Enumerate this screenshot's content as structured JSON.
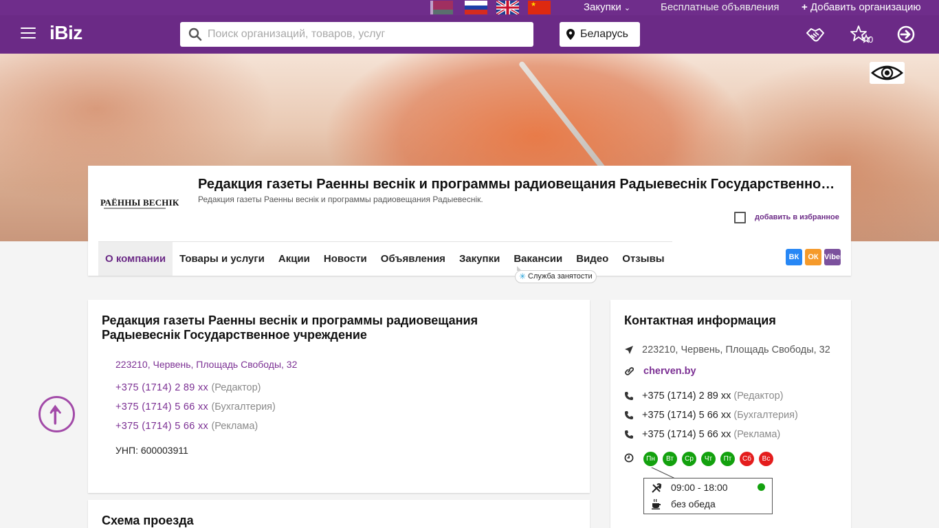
{
  "header": {
    "languages": [
      "by",
      "ru",
      "en",
      "cn"
    ],
    "top_links": {
      "purchases": "Закупки",
      "free_ads": "Бесплатные объявления",
      "add_org": "Добавить организацию"
    },
    "logo": "iBiz",
    "search": {
      "placeholder": "Поиск организаций, товаров, услуг",
      "value": ""
    },
    "country": "Беларусь",
    "favorites_count": "0",
    "icons": [
      "menu-icon",
      "handshake-icon",
      "stars-icon",
      "login-icon",
      "eye-icon",
      "search-icon",
      "map-pin-icon"
    ],
    "brand_color": "#6b2a86"
  },
  "company": {
    "logo_text": "РАЁННЫ ВЕСНІК",
    "title": "Редакция газеты Раенны веснік и программы радиовещания Радыевеснік Государственное учреждение",
    "subtitle": "Редакция газеты Раенны веснік и программы радиовещания Радыевеснік.",
    "favorite_label": "добавить в избранное",
    "tabs": [
      "О компании",
      "Товары и услуги",
      "Акции",
      "Новости",
      "Объявления",
      "Закупки",
      "Вакансии",
      "Видео",
      "Отзывы"
    ],
    "active_tab": "О компании",
    "employment_badge": "Служба занятости",
    "social": [
      "ВК",
      "ОК",
      "Viber"
    ]
  },
  "main": {
    "heading": "Редакция газеты Раенны веснік и программы радиовещания Радыевеснік Государственное учреждение",
    "address": "223210, Червень, Площадь Свободы, 32",
    "phones": [
      {
        "number": "+375 (1714) 2 89 xx",
        "note": "(Редактор)"
      },
      {
        "number": "+375 (1714) 5 66 xx",
        "note": "(Бухгалтерия)"
      },
      {
        "number": "+375 (1714) 5 66 xx",
        "note": "(Реклама)"
      }
    ],
    "unp": "УНП: 600003911",
    "map_heading": "Схема проезда"
  },
  "contact": {
    "heading": "Контактная информация",
    "address": "223210, Червень, Площадь Свободы, 32",
    "site": "cherven.by",
    "phones": [
      {
        "number": "+375 (1714) 2 89 xx",
        "note": "(Редактор)"
      },
      {
        "number": "+375 (1714) 5 66 xx",
        "note": "(Бухгалтерия)"
      },
      {
        "number": "+375 (1714) 5 66 xx",
        "note": "(Реклама)"
      }
    ],
    "days": [
      {
        "label": "Пн",
        "open": true
      },
      {
        "label": "Вт",
        "open": true
      },
      {
        "label": "Ср",
        "open": true
      },
      {
        "label": "Чт",
        "open": true
      },
      {
        "label": "Пт",
        "open": true
      },
      {
        "label": "Сб",
        "open": false
      },
      {
        "label": "Вс",
        "open": false
      }
    ],
    "hours": "09:00 - 18:00",
    "lunch": "без обеда",
    "status_colors": {
      "open": "#13a10e",
      "closed": "#e41d1d"
    }
  }
}
